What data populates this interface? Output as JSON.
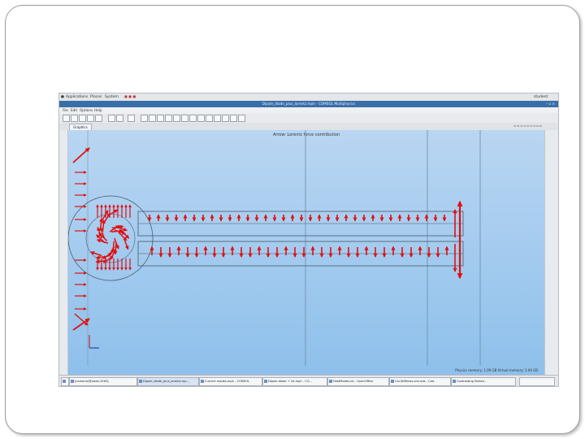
{
  "topbar": {
    "applications": "Applications",
    "places": "Places",
    "system": "System",
    "user": "student"
  },
  "window": {
    "title": "Dipole_diode_plus_lorentz.mph - COMSOL Multiphysics"
  },
  "menu": [
    "File",
    "Edit",
    "Options",
    "Help"
  ],
  "view_tab": "Graphics",
  "plot": {
    "title": "Arrow: Lorentz force contribution"
  },
  "status": "Physics memory: 1.09 GB   Virtual memory: 2.04 GB",
  "taskbar": [
    "[cameron@node-2563]",
    "Dipole_diode_plus_lorentz.mp...",
    "Current modes.mph - COMSOL",
    "Dipole diode + 2d.mph - CO...",
    "FieldModes.nb - OpenOffice",
    "Cal.Stiffness.xml.ods - Calc",
    "Contrasting Sketch..."
  ],
  "colors": {
    "arrow": "#e01010",
    "plot_bg_top": "#b9d6f2",
    "plot_bg_bottom": "#8ec0eb",
    "title_bar": "#3a6ea8"
  }
}
